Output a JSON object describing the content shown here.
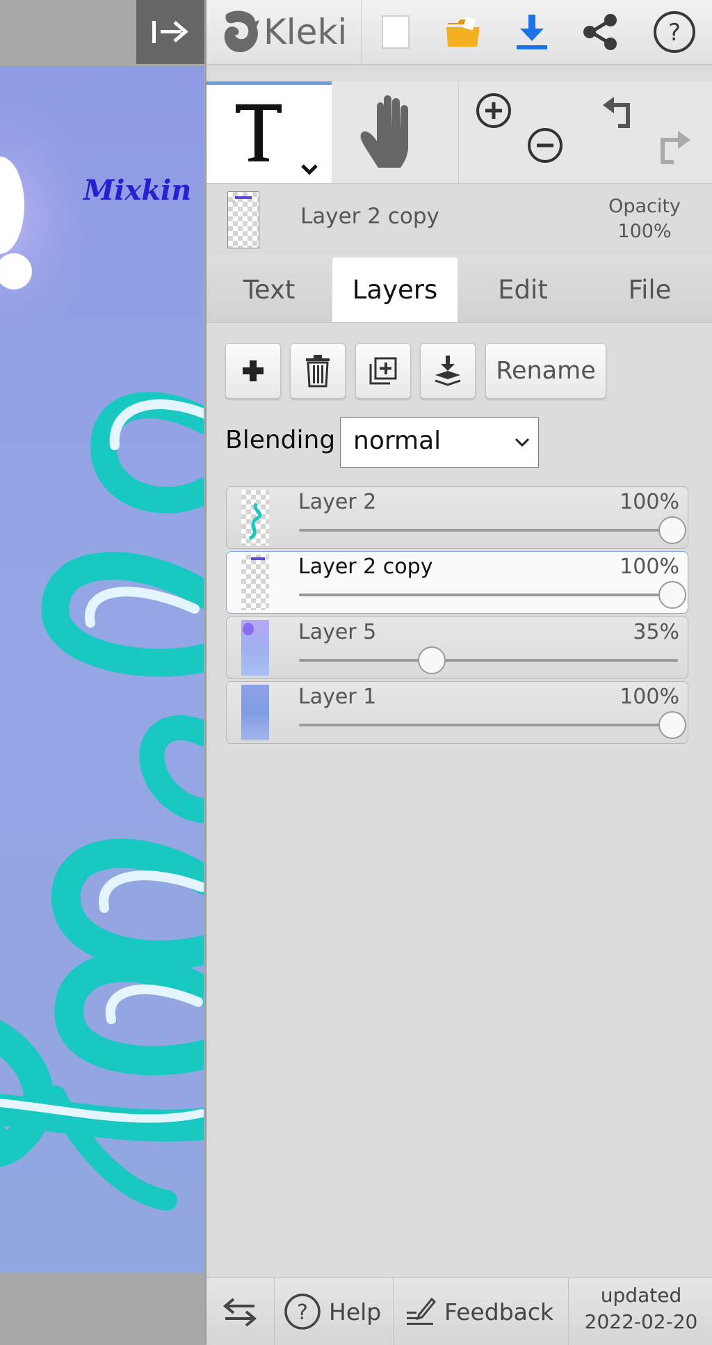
{
  "canvas": {
    "artwork_text": "Mixkin"
  },
  "topbar": {
    "logo_text": "Kleki",
    "icons": [
      "new-image-icon",
      "open-folder-icon",
      "download-icon",
      "share-icon",
      "help-icon"
    ]
  },
  "tools": {
    "active": "text",
    "items": [
      "text-tool",
      "hand-tool",
      "zoom-in",
      "zoom-out",
      "undo",
      "redo"
    ]
  },
  "layer_info": {
    "current_name": "Layer 2 copy",
    "opacity_label": "Opacity",
    "opacity_value": "100%"
  },
  "tabs": [
    {
      "label": "Text",
      "active": false
    },
    {
      "label": "Layers",
      "active": true
    },
    {
      "label": "Edit",
      "active": false
    },
    {
      "label": "File",
      "active": false
    }
  ],
  "layers_panel": {
    "rename_label": "Rename",
    "blending_label": "Blending",
    "blending_value": "normal",
    "layers": [
      {
        "name": "Layer 2",
        "opacity": "100%",
        "opacity_fraction": 1.0,
        "selected": false
      },
      {
        "name": "Layer 2 copy",
        "opacity": "100%",
        "opacity_fraction": 1.0,
        "selected": true
      },
      {
        "name": "Layer 5",
        "opacity": "35%",
        "opacity_fraction": 0.35,
        "selected": false
      },
      {
        "name": "Layer 1",
        "opacity": "100%",
        "opacity_fraction": 1.0,
        "selected": false
      }
    ]
  },
  "footer": {
    "help_label": "Help",
    "feedback_label": "Feedback",
    "updated_label": "updated",
    "updated_date": "2022-02-20"
  },
  "colors": {
    "accent_blue": "#1a73e8",
    "folder_yellow": "#f5b021",
    "teal": "#19c9c1",
    "selected_border": "#7fa6df"
  }
}
